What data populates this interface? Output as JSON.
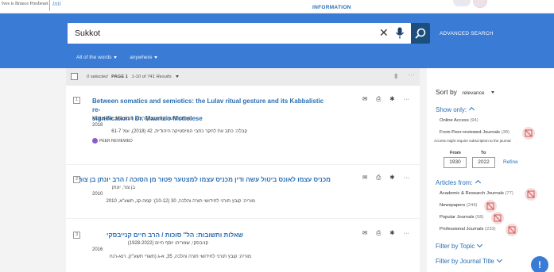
{
  "topbar": {
    "logo_text": "Ives is Bräuce Presbeuet",
    "logo_mark": "inii",
    "link": "INFORMATION"
  },
  "search": {
    "query": "Sukkot",
    "advanced_label": "ADVANCED SEARCH",
    "scope_words": "All of the words",
    "scope_field": "anywhere"
  },
  "results_header": {
    "selected": "0 selected",
    "page_label": "PAGE 1",
    "range": "1-10 of 741 Results"
  },
  "results": [
    {
      "num": "1",
      "title_line1": "Between somatics and semiotics: the Lulav ritual gesture and its Kabbalistic re-",
      "title_line2": "signification \\ Dr. Maurizio Mottolese",
      "author": "Mottolese, Maurizio אוניברסיטת ספיאנצה) רומא)",
      "year": "2018",
      "source": "קבלה: כתב עת לחקר כתבי המיסטיקה היהודית, 42 (2018), עמ' 61-7",
      "badge": "PEER REVIEWED"
    },
    {
      "num": "2",
      "title_line1": "מכניס עצמו לאונס ביטול עשה ודין מכניס עצמו למצטער פטור מן הסוכה / הרב יונתן בן צור",
      "author": "בן צור, יונתן",
      "year": "2010",
      "source": "מוריה: קובץ תורני לחידושי תורה והלכה, 30 (10-12): קמה-קנ, תשע\"א, 2010"
    },
    {
      "num": "3",
      "title_line1": "שאלות ותשובות: הל\" סוכות / הרב חיים קנייבסקי",
      "author": "קניבסקי, שמריהו יוסף חיים (1928-2022)",
      "year": "2016",
      "source": "מוריה: קובץ תורני לחידושי תורה והלכה, 35, א-ג (תשרי תשע\"ז), רנא-רנח"
    }
  ],
  "sidebar": {
    "sort_label": "Sort by",
    "sort_value": "relevance",
    "show_only": "Show only:",
    "show_items": [
      {
        "label": "Online Access",
        "count": "(94)"
      },
      {
        "label": "From Peer-reviewed Journals",
        "count": "(38)"
      }
    ],
    "note": "Access might require subscription to the journal",
    "from_label": "From",
    "to_label": "To",
    "from_value": "1930",
    "to_value": "2022",
    "refine": "Refine",
    "articles_from": "Articles from:",
    "article_items": [
      {
        "label": "Academic & Research Journals",
        "count": "(77)"
      },
      {
        "label": "Newspapers",
        "count": "(244)"
      },
      {
        "label": "Popular Journals",
        "count": "(68)"
      },
      {
        "label": "Professional Journals",
        "count": "(233)"
      }
    ],
    "filter_topic": "Filter by Topic",
    "filter_journal": "Filter by Journal Title"
  },
  "icons": {
    "email": "email-icon",
    "print": "print-icon",
    "pin": "pin-icon",
    "more": "more-icon"
  },
  "colors": {
    "band": "#3a7bd5",
    "link": "#2a6eb3",
    "search_button": "#1c4f7d"
  }
}
